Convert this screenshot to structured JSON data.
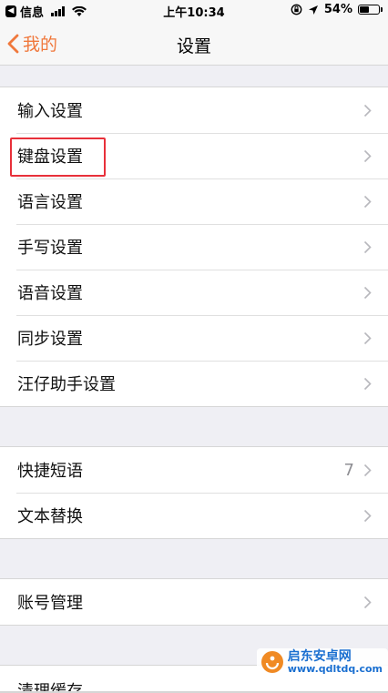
{
  "status_bar": {
    "back_app": "信息",
    "time": "上午10:34",
    "battery_text": "54%",
    "battery_level": 0.54
  },
  "nav": {
    "back_label": "我的",
    "title": "设置",
    "accent_color": "#f0783c"
  },
  "groups": [
    {
      "items": [
        {
          "label": "输入设置",
          "value": ""
        },
        {
          "label": "键盘设置",
          "value": ""
        },
        {
          "label": "语言设置",
          "value": ""
        },
        {
          "label": "手写设置",
          "value": ""
        },
        {
          "label": "语音设置",
          "value": ""
        },
        {
          "label": "同步设置",
          "value": ""
        },
        {
          "label": "汪仔助手设置",
          "value": ""
        }
      ]
    },
    {
      "items": [
        {
          "label": "快捷短语",
          "value": "7"
        },
        {
          "label": "文本替换",
          "value": ""
        }
      ]
    },
    {
      "items": [
        {
          "label": "账号管理",
          "value": ""
        }
      ]
    },
    {
      "items": [
        {
          "label": "清理缓存",
          "value": ""
        }
      ]
    }
  ],
  "highlight": {
    "target": "键盘设置",
    "color": "#e8303a"
  },
  "watermark": {
    "name": "启东安卓网",
    "url": "www.qdltdq.com"
  }
}
